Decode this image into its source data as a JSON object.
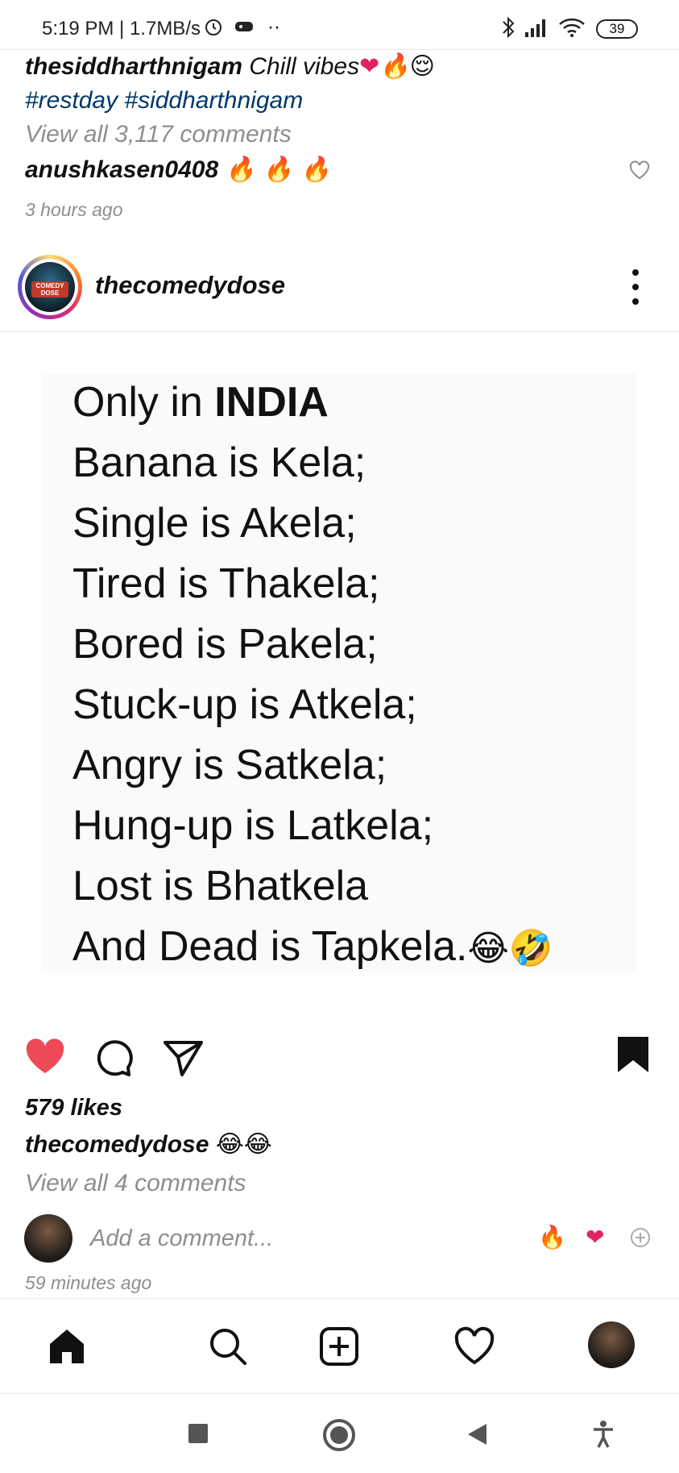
{
  "status_bar": {
    "time_speed": "5:19 PM | 1.7MB/s",
    "battery": "39"
  },
  "previous_post": {
    "username": "thesiddharthnigam",
    "caption_text": "Chill vibes",
    "hashtags": "#restday #siddharthnigam",
    "view_all": "View all 3,117 comments",
    "comment_user": "anushkasen0408",
    "time": "3 hours ago"
  },
  "post": {
    "username": "thecomedydose",
    "avatar_text": "COMEDY DOSE",
    "image_lines": [
      {
        "pre": "Only in ",
        "bold": "INDIA"
      },
      {
        "pre": "Banana is Kela;"
      },
      {
        "pre": "Single is Akela;"
      },
      {
        "pre": "Tired is Thakela;"
      },
      {
        "pre": "Bored is Pakela;"
      },
      {
        "pre": "Stuck-up is Atkela;"
      },
      {
        "pre": "Angry is Satkela;"
      },
      {
        "pre": "Hung-up is Latkela;"
      },
      {
        "pre": "Lost is Bhatkela"
      },
      {
        "pre": "And Dead is Tapkela."
      }
    ],
    "likes": "579 likes",
    "caption_user": "thecomedydose",
    "view_all": "View all 4 comments",
    "add_comment_placeholder": "Add a comment...",
    "time_ago": "59 minutes ago"
  },
  "colors": {
    "like_red": "#ed4956",
    "link_blue": "#00376b",
    "muted": "#8e8e8e"
  },
  "icons": {
    "like": "heart-filled-icon",
    "comment": "comment-bubble-icon",
    "share": "paper-plane-icon",
    "save": "bookmark-filled-icon"
  }
}
